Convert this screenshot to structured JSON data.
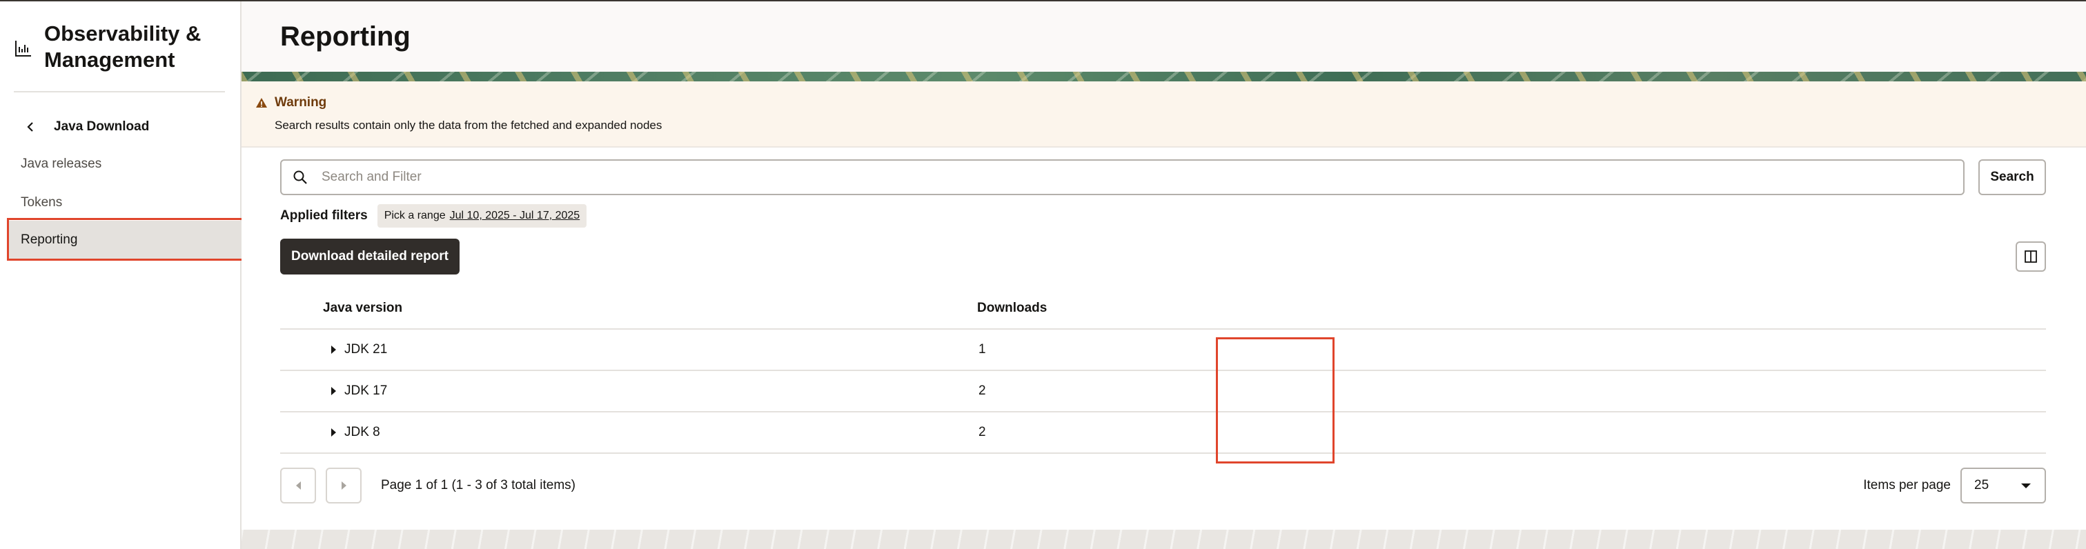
{
  "sidebar": {
    "brand_title": "Observability & Management",
    "back_label": "Java Download",
    "items": [
      {
        "label": "Java releases"
      },
      {
        "label": "Tokens"
      },
      {
        "label": "Reporting"
      }
    ],
    "active_item": "Reporting"
  },
  "header": {
    "title": "Reporting"
  },
  "warning": {
    "title": "Warning",
    "message": "Search results contain only the data from the fetched and expanded nodes"
  },
  "search": {
    "placeholder": "Search and Filter",
    "button_label": "Search"
  },
  "filters": {
    "label": "Applied filters",
    "chip_prefix": "Pick a range",
    "chip_value": "Jul 10, 2025 - Jul 17, 2025"
  },
  "toolbar": {
    "download_label": "Download detailed report"
  },
  "table": {
    "columns": [
      "Java version",
      "Downloads"
    ],
    "rows": [
      {
        "version": "JDK 21",
        "downloads": "1"
      },
      {
        "version": "JDK 17",
        "downloads": "2"
      },
      {
        "version": "JDK 8",
        "downloads": "2"
      }
    ]
  },
  "pagination": {
    "info": "Page 1 of 1 (1 - 3 of 3 total items)",
    "items_per_page_label": "Items per page",
    "items_per_page_value": "25"
  },
  "colors": {
    "highlight": "#e0452c",
    "primary_button": "#312d2a",
    "warning_text": "#6f3b0c",
    "warning_bg": "#fcf5ec"
  },
  "icons": {
    "brand": "chart-icon",
    "back": "chevron-left-icon",
    "warning": "warning-triangle-icon",
    "search": "search-icon",
    "columns": "columns-panel-icon",
    "expand": "caret-right-icon",
    "prev": "chevron-left-icon",
    "next": "chevron-right-icon",
    "dropdown": "caret-down-icon"
  }
}
